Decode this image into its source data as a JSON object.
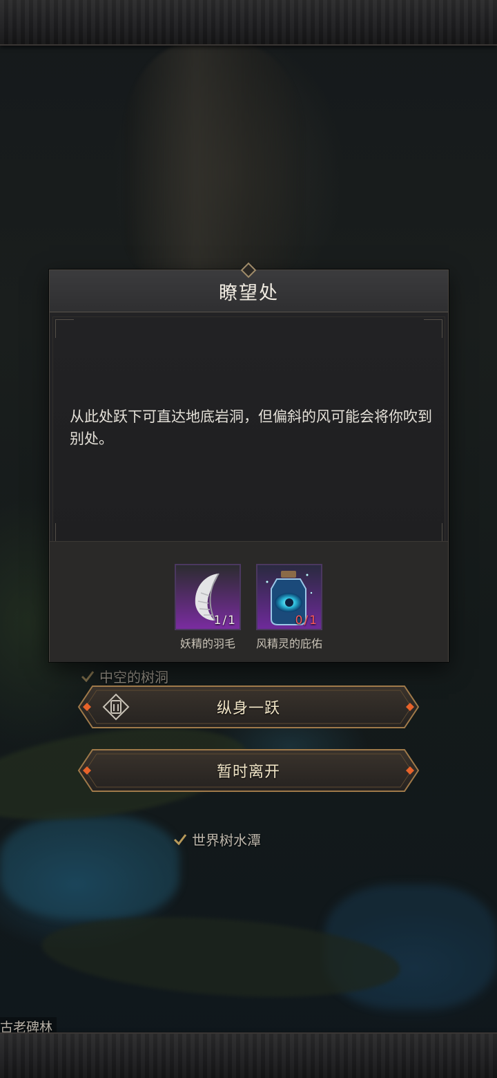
{
  "dialog": {
    "title": "瞭望处",
    "description": "从此处跃下可直达地底岩洞，但偏斜的风可能会将你吹到别处。"
  },
  "items": [
    {
      "name": "妖精的羽毛",
      "count": "1/1",
      "icon": "feather-icon",
      "sufficient": true
    },
    {
      "name": "风精灵的庇佑",
      "count": "0/1",
      "icon": "potion-bottle-icon",
      "sufficient": false
    }
  ],
  "buttons": {
    "leap_label": "纵身一跃",
    "leave_label": "暂时离开"
  },
  "map_labels": {
    "hollow": "中空的树洞",
    "pool": "世界树水潭",
    "stele": "古老碑林"
  },
  "colors": {
    "accent_orange": "#e8632a",
    "button_gold": "#a07a4a",
    "count_lacking": "#ff5a5a"
  }
}
